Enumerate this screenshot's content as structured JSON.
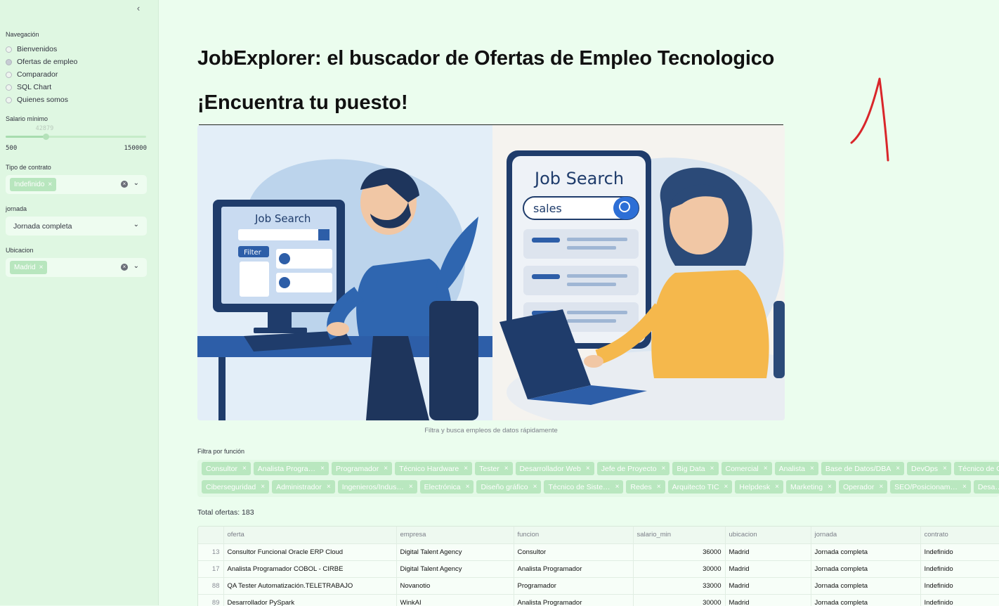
{
  "sidebar": {
    "collapse_icon": "‹",
    "nav_label": "Navegación",
    "nav_items": [
      {
        "label": "Bienvenidos",
        "selected": false
      },
      {
        "label": "Ofertas de empleo",
        "selected": true
      },
      {
        "label": "Comparador",
        "selected": false
      },
      {
        "label": "SQL Chart",
        "selected": false
      },
      {
        "label": "Quienes somos",
        "selected": false
      }
    ],
    "salary": {
      "label": "Salario mínimo",
      "value": "42879",
      "min": "500",
      "max": "150000",
      "fraction": 0.283
    },
    "contract": {
      "label": "Tipo de contrato",
      "chip": "Indefinido"
    },
    "jornada": {
      "label": "jornada",
      "value": "Jornada completa"
    },
    "ubicacion": {
      "label": "Ubicacion",
      "chip": "Madrid"
    }
  },
  "main": {
    "title": "JobExplorer: el buscador de Ofertas de Empleo Tecnologico",
    "subtitle": "¡Encuentra tu puesto!",
    "hero": {
      "left_screen_title": "Job Search",
      "left_filter": "Filter",
      "right_screen_title": "Job Search",
      "right_search_text": "sales"
    },
    "caption": "Filtra y busca empleos de datos rápidamente",
    "filter_label": "Filtra por función",
    "chips_row1": [
      "Consultor",
      "Analista Progra…",
      "Programador",
      "Técnico Hardware",
      "Tester",
      "Desarrollador Web",
      "Jefe de Proyecto",
      "Big Data",
      "Comercial",
      "Analista",
      "Base de Datos/DBA",
      "DevOps",
      "Técnico de G…"
    ],
    "chips_row2": [
      "Ciberseguridad",
      "Administrador",
      "Ingenieros/Indus…",
      "Electrónica",
      "Diseño gráfico",
      "Técnico de Siste…",
      "Redes",
      "Arquitecto TIC",
      "Helpdesk",
      "Marketing",
      "Operador",
      "SEO/Posicionam…",
      "Desa…"
    ],
    "total": "Total ofertas: 183",
    "table": {
      "columns": [
        "",
        "oferta",
        "empresa",
        "funcion",
        "salario_min",
        "ubicacion",
        "jornada",
        "contrato"
      ],
      "rows": [
        [
          "13",
          "Consultor Funcional Oracle ERP Cloud",
          "Digital Talent Agency",
          "Consultor",
          "36000",
          "Madrid",
          "Jornada completa",
          "Indefinido"
        ],
        [
          "17",
          "Analista Programador COBOL - CIRBE",
          "Digital Talent Agency",
          "Analista Programador",
          "30000",
          "Madrid",
          "Jornada completa",
          "Indefinido"
        ],
        [
          "88",
          "QA Tester Automatización.TELETRABAJO",
          "Novanotio",
          "Programador",
          "33000",
          "Madrid",
          "Jornada completa",
          "Indefinido"
        ],
        [
          "89",
          "Desarrollador PySpark",
          "WinkAI",
          "Analista Programador",
          "30000",
          "Madrid",
          "Jornada completa",
          "Indefinido"
        ]
      ]
    }
  }
}
